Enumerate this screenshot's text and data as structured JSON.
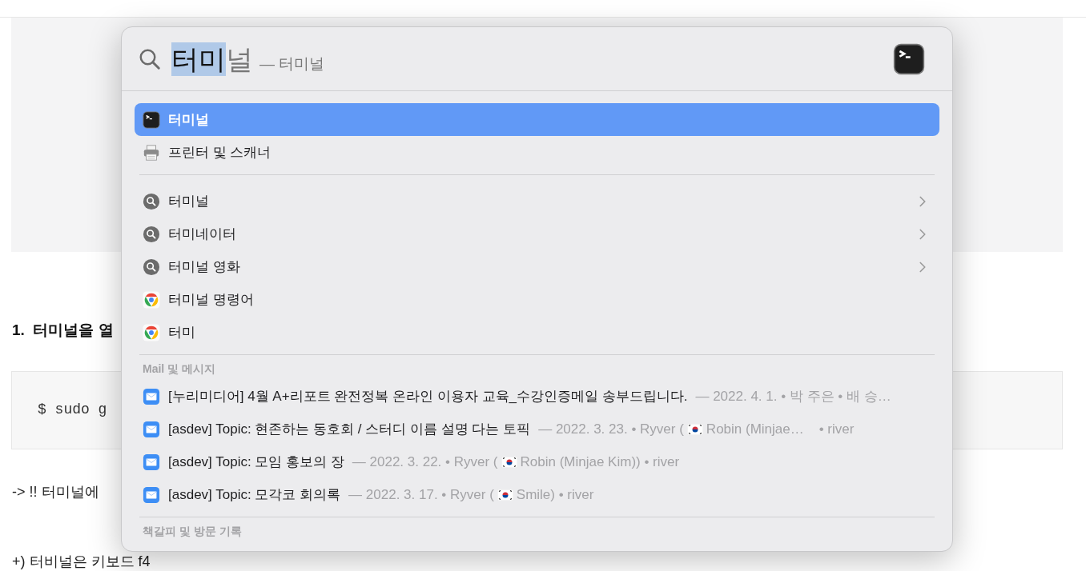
{
  "page": {
    "heading": "1.  터미널을 열",
    "code": "$ sudo g",
    "note": "-> !! 터미널에",
    "tip": "+) 터비널은 키보드 f4"
  },
  "spotlight": {
    "query_selected": "터미",
    "query_completion": "널",
    "suggestion": "— 터미널",
    "top_hits": [
      {
        "label": "터미널",
        "kind": "terminal",
        "selected": true
      },
      {
        "label": "프린터 및 스캐너",
        "kind": "printer",
        "selected": false
      }
    ],
    "suggestions": [
      {
        "label": "터미널",
        "kind": "search",
        "selected": false
      },
      {
        "label": "터미네이터",
        "kind": "search",
        "selected": false
      },
      {
        "label": "터미널 영화",
        "kind": "search",
        "selected": false
      },
      {
        "label": "터미널 명령어",
        "kind": "browser",
        "selected": false
      },
      {
        "label": "터미",
        "kind": "browser",
        "selected": false
      }
    ],
    "mail_section": "Mail 및 메시지",
    "mail": [
      {
        "subject": "[누리미디어] 4월 A+리포트 완전정복 온라인 이용자 교육_수강인증메일 송부드립니다.",
        "meta": "— 2022. 4. 1. • 박 주은 • 배 승…",
        "flag": false,
        "selected": false
      },
      {
        "subject": "[asdev] Topic: 현존하는 동호회 / 스터디 이름 설명 다는 토픽",
        "meta": "— 2022. 3. 23. • Ryver (",
        "flag": true,
        "meta_after": "Robin (Minjae…    • river",
        "selected": false
      },
      {
        "subject": "[asdev] Topic: 모임 홍보의 장",
        "meta": "— 2022. 3. 22. • Ryver (",
        "flag": true,
        "meta_after": "Robin (Minjae Kim)) • river",
        "selected": false
      },
      {
        "subject": "[asdev] Topic: 모각코 회의록",
        "meta": "— 2022. 3. 17. • Ryver (",
        "flag": true,
        "meta_after": "Smile) • river",
        "selected": false
      }
    ],
    "bookmarks_section": "책갈피 및 방문 기록"
  }
}
